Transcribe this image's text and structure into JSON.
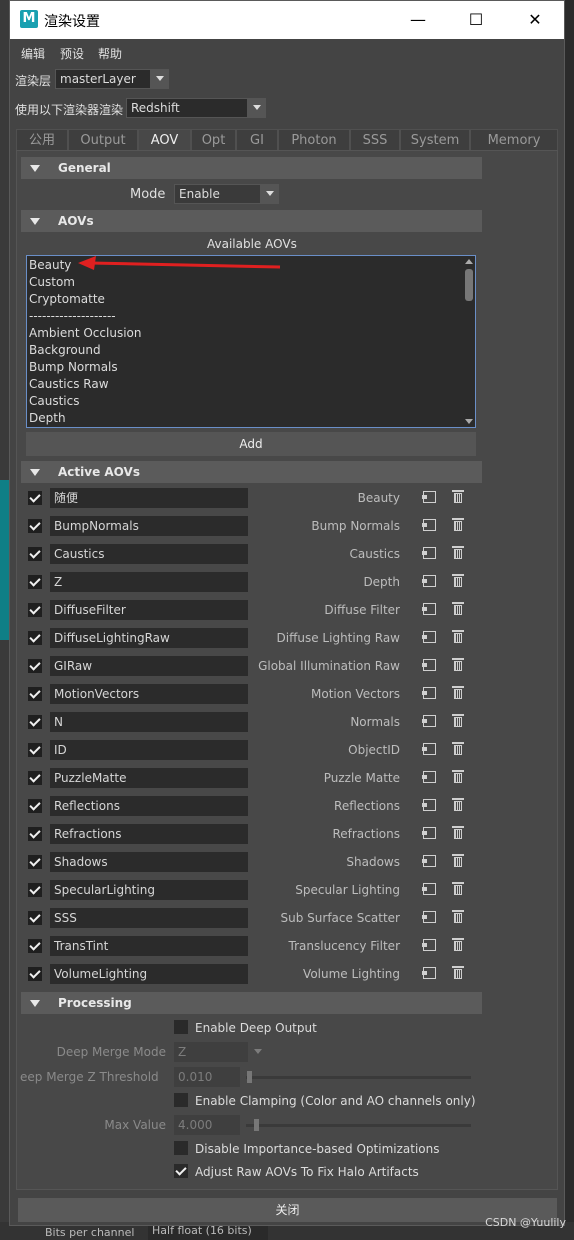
{
  "window": {
    "title": "渲染设置",
    "app_icon": "M",
    "app_icon_name": "maya-icon",
    "controls": {
      "minimize": "—",
      "maximize": "☐",
      "close": "✕"
    }
  },
  "menu": [
    "编辑",
    "预设",
    "帮助"
  ],
  "render_layer": {
    "label": "渲染层",
    "value": "masterLayer"
  },
  "renderer": {
    "label": "使用以下渲染器渲染",
    "value": "Redshift"
  },
  "tabs": [
    {
      "label": "公用",
      "active": false
    },
    {
      "label": "Output",
      "active": false
    },
    {
      "label": "AOV",
      "active": true
    },
    {
      "label": "Opt",
      "active": false
    },
    {
      "label": "GI",
      "active": false
    },
    {
      "label": "Photon",
      "active": false
    },
    {
      "label": "SSS",
      "active": false
    },
    {
      "label": "System",
      "active": false
    },
    {
      "label": "Memory",
      "active": false
    }
  ],
  "general": {
    "header": "General",
    "mode_label": "Mode",
    "mode_value": "Enable"
  },
  "aovs": {
    "header": "AOVs",
    "available_label": "Available AOVs",
    "available": [
      "Beauty",
      "Custom",
      "Cryptomatte",
      "--------------------",
      "Ambient Occlusion",
      "Background",
      "Bump Normals",
      "Caustics Raw",
      "Caustics",
      "Depth"
    ],
    "add_label": "Add",
    "annotation_color": "#e02020"
  },
  "active_aovs": {
    "header": "Active AOVs",
    "rows": [
      {
        "name": "随便",
        "type": "Beauty",
        "enabled": true
      },
      {
        "name": "BumpNormals",
        "type": "Bump Normals",
        "enabled": true
      },
      {
        "name": "Caustics",
        "type": "Caustics",
        "enabled": true
      },
      {
        "name": "Z",
        "type": "Depth",
        "enabled": true
      },
      {
        "name": "DiffuseFilter",
        "type": "Diffuse Filter",
        "enabled": true
      },
      {
        "name": "DiffuseLightingRaw",
        "type": "Diffuse Lighting Raw",
        "enabled": true
      },
      {
        "name": "GIRaw",
        "type": "Global Illumination Raw",
        "enabled": true
      },
      {
        "name": "MotionVectors",
        "type": "Motion Vectors",
        "enabled": true
      },
      {
        "name": "N",
        "type": "Normals",
        "enabled": true
      },
      {
        "name": "ID",
        "type": "ObjectID",
        "enabled": true
      },
      {
        "name": "PuzzleMatte",
        "type": "Puzzle Matte",
        "enabled": true
      },
      {
        "name": "Reflections",
        "type": "Reflections",
        "enabled": true
      },
      {
        "name": "Refractions",
        "type": "Refractions",
        "enabled": true
      },
      {
        "name": "Shadows",
        "type": "Shadows",
        "enabled": true
      },
      {
        "name": "SpecularLighting",
        "type": "Specular Lighting",
        "enabled": true
      },
      {
        "name": "SSS",
        "type": "Sub Surface Scatter",
        "enabled": true
      },
      {
        "name": "TransTint",
        "type": "Translucency Filter",
        "enabled": true
      },
      {
        "name": "VolumeLighting",
        "type": "Volume Lighting",
        "enabled": true
      }
    ]
  },
  "processing": {
    "header": "Processing",
    "enable_deep_output": {
      "label": "Enable Deep Output",
      "checked": false
    },
    "deep_merge_mode": {
      "label": "Deep Merge Mode",
      "value": "Z"
    },
    "deep_merge_z_threshold": {
      "label": "eep Merge Z Threshold",
      "value": "0.010"
    },
    "enable_clamping": {
      "label": "Enable Clamping (Color and AO channels only)",
      "checked": false
    },
    "max_value": {
      "label": "Max Value",
      "value": "4.000"
    },
    "disable_importance": {
      "label": "Disable Importance-based Optimizations",
      "checked": false
    },
    "adjust_raw_aovs": {
      "label": "Adjust Raw AOVs To Fix Halo Artifacts",
      "checked": true
    }
  },
  "close_label": "关闭",
  "background": {
    "bits_label": "Bits per channel",
    "bits_value": "Half float (16 bits)"
  },
  "watermark": "CSDN @Yuulily"
}
